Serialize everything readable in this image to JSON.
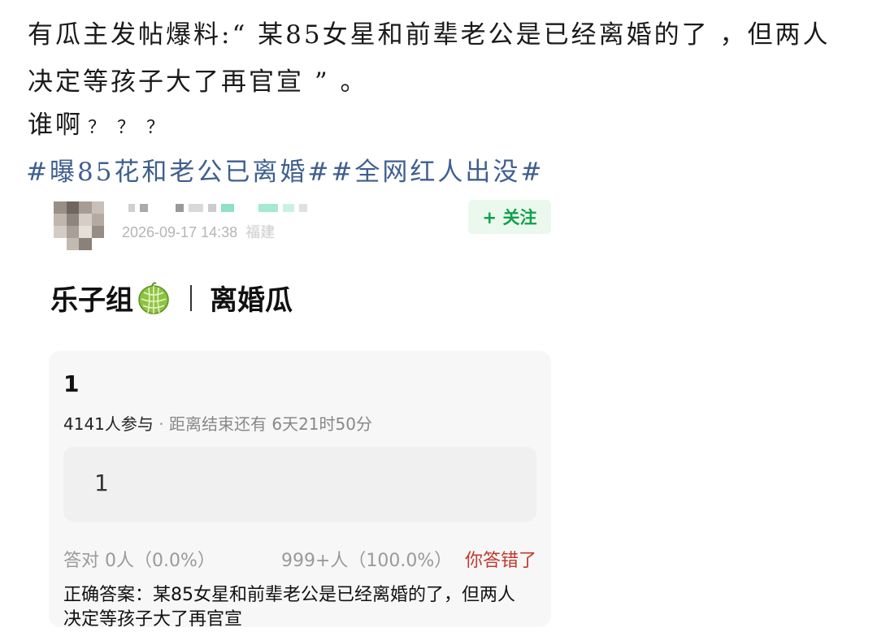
{
  "post": {
    "caption": "有瓜主发帖爆料:“ 某85女星和前辈老公是已经离婚的了 ，但两人决定等孩子大了再官宣 ” 。",
    "question": "谁啊",
    "question_marks": "？？？",
    "hashtags": [
      "#曝85花和老公已离婚#",
      "#全网红人出没#"
    ]
  },
  "author": {
    "timestamp": "2026-09-17 14:38",
    "location": "福建",
    "follow_label": "+ 关注"
  },
  "group": {
    "name": "乐子组",
    "icon": "melon-icon",
    "topic": "离婚瓜"
  },
  "quiz": {
    "title": "1",
    "participants": "4141人参与",
    "separator": "·",
    "time_left": "距离结束还有 6天21时50分",
    "option_text": "1",
    "correct_label": "答对  0人（0.0%）",
    "wrong_count": "999+人（100.0%）",
    "wrong_label": "你答错了",
    "answer": "正确答案：某85女星和前辈老公是已经离婚的了，但两人决定等孩子大了再官宣"
  },
  "colors": {
    "hashtag": "#3f5f8f",
    "follow_bg": "#eaf8ee",
    "follow_text": "#0fa14a",
    "wrong": "#c0392b"
  }
}
